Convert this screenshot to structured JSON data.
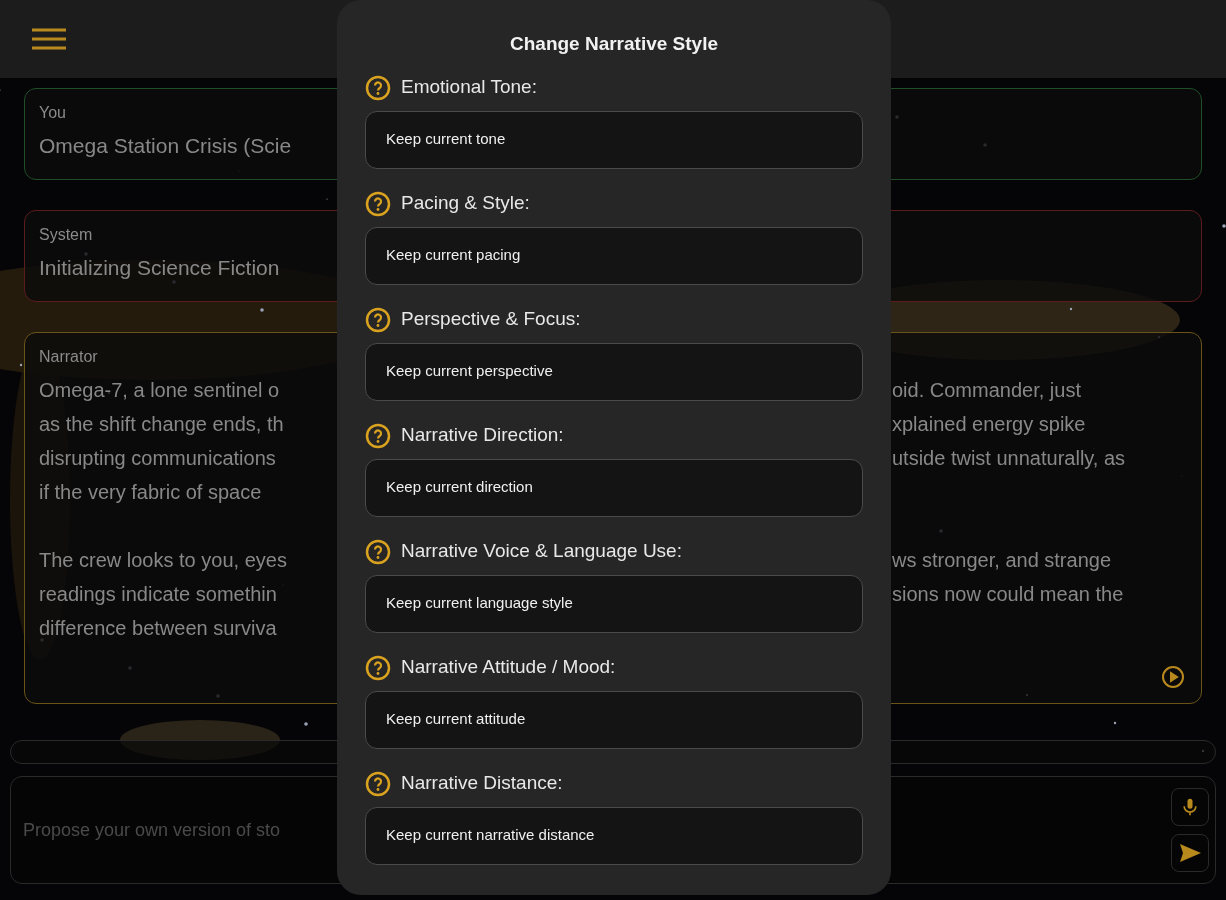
{
  "messages": [
    {
      "kind": "user",
      "sender": "You",
      "paragraphs": [
        [
          {
            "left": "Omega Station Crisis (Scie"
          }
        ]
      ]
    },
    {
      "kind": "system",
      "sender": "System",
      "paragraphs": [
        [
          {
            "left": "Initializing Science Fiction"
          }
        ]
      ]
    },
    {
      "kind": "narrator",
      "sender": "Narrator",
      "paragraphs": [
        [
          {
            "left": "Omega-7, a lone sentinel o",
            "right": "oid. Commander, just"
          },
          {
            "left": "as the shift change ends, th",
            "right": "xplained energy spike"
          },
          {
            "left": "disrupting communications",
            "right": "utside twist unnaturally, as"
          },
          {
            "left": "if the very fabric of space"
          }
        ],
        [
          {
            "left": "The crew looks to you, eyes",
            "right": "ws stronger, and strange"
          },
          {
            "left": "readings indicate somethin",
            "right": "sions now could mean the"
          },
          {
            "left": "difference between surviva"
          }
        ]
      ]
    }
  ],
  "composer": {
    "placeholder": "Propose your own version of sto"
  },
  "dialog": {
    "title": "Change Narrative Style",
    "fields": [
      {
        "label": "Emotional Tone:",
        "value": "Keep current tone"
      },
      {
        "label": "Pacing & Style:",
        "value": "Keep current pacing"
      },
      {
        "label": "Perspective & Focus:",
        "value": "Keep current perspective"
      },
      {
        "label": "Narrative Direction:",
        "value": "Keep current direction"
      },
      {
        "label": "Narrative Voice & Language Use:",
        "value": "Keep current language style"
      },
      {
        "label": "Narrative Attitude / Mood:",
        "value": "Keep current attitude"
      },
      {
        "label": "Narrative Distance:",
        "value": "Keep current narrative distance"
      }
    ]
  }
}
